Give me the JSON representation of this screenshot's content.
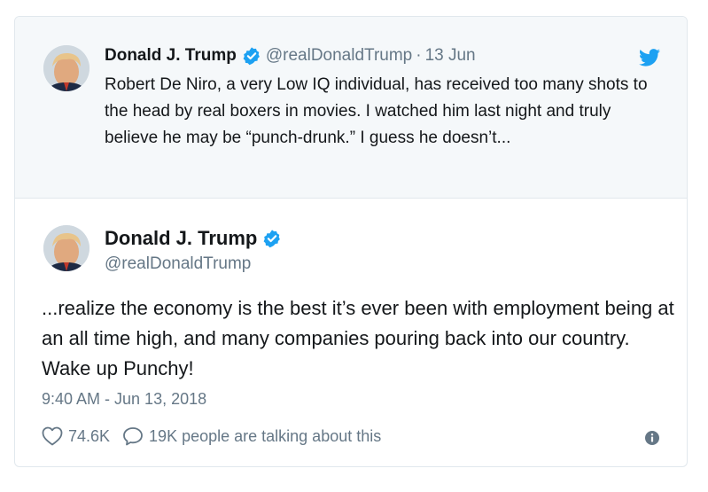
{
  "quoted_tweet": {
    "author_name": "Donald J. Trump",
    "handle": "@realDonaldTrump",
    "separator": "·",
    "date": "13 Jun",
    "text": "Robert De Niro, a very Low IQ individual, has received too many shots to the head by real boxers in movies. I watched him last night and truly believe he may be “punch-drunk.” I guess he doesn’t..."
  },
  "tweet": {
    "author_name": "Donald J. Trump",
    "handle": "@realDonaldTrump",
    "text": "...realize the economy is the best it’s ever been with employment being at an all time high, and many companies pouring back into our country. Wake up Punchy!",
    "timestamp": "9:40 AM - Jun 13, 2018",
    "likes": "74.6K",
    "conversation": "19K people are talking about this"
  },
  "icons": {
    "verified": "verified-badge-icon",
    "bird": "twitter-bird-icon",
    "like": "heart-icon",
    "reply": "speech-bubble-icon",
    "info": "info-icon"
  },
  "colors": {
    "brand_blue": "#1da1f2",
    "text": "#14171a",
    "muted": "#657786",
    "parent_bg": "#f5f8fa",
    "border": "#e1e8ed"
  }
}
